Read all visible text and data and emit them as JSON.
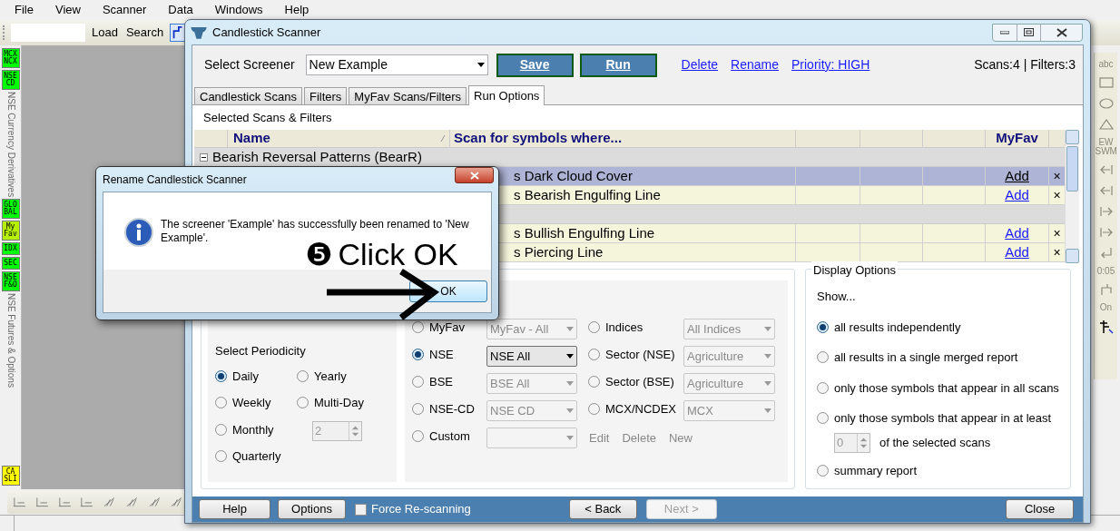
{
  "menu": [
    "File",
    "View",
    "Scanner",
    "Data",
    "Windows",
    "Help"
  ],
  "toolbar": {
    "buttons": [
      "Load",
      "Search"
    ]
  },
  "sidebar": [
    {
      "kind": "badge",
      "lines": [
        "MCX",
        "NCX"
      ],
      "color": "#00ff00"
    },
    {
      "kind": "badge",
      "lines": [
        "NSE",
        "CD"
      ],
      "color": "#00ff00"
    },
    {
      "kind": "label",
      "text": "NSE Currency Derivatives"
    },
    {
      "kind": "badge",
      "lines": [
        "GLO",
        "BAL"
      ],
      "color": "#00ff00"
    },
    {
      "kind": "badge",
      "lines": [
        "My",
        "Fav"
      ],
      "color": "#b4f000"
    },
    {
      "kind": "badge",
      "lines": [
        "IDX"
      ],
      "color": "#00ff00"
    },
    {
      "kind": "badge",
      "lines": [
        "SEC"
      ],
      "color": "#00ff00"
    },
    {
      "kind": "badge",
      "lines": [
        "NSE",
        "F&O"
      ],
      "color": "#00ff00"
    },
    {
      "kind": "label",
      "text": "NSE Futures & Options"
    },
    {
      "kind": "badge",
      "lines": [
        "CA",
        "SLI"
      ],
      "color": "#ffff00"
    }
  ],
  "right_strip": [
    {
      "kind": "text",
      "text": "abc"
    },
    {
      "kind": "rect"
    },
    {
      "kind": "ellipse"
    },
    {
      "kind": "triangle"
    },
    {
      "kind": "text",
      "text": "EW SWM"
    },
    {
      "kind": "arrow_left"
    },
    {
      "kind": "arrow_left"
    },
    {
      "kind": "arrow_right"
    },
    {
      "kind": "arrow_right"
    },
    {
      "kind": "return"
    },
    {
      "kind": "text",
      "text": "0:05"
    },
    {
      "kind": "route"
    },
    {
      "kind": "text",
      "text": "On"
    },
    {
      "kind": "cursor"
    }
  ],
  "window": {
    "title": "Candlestick Scanner",
    "screener_label": "Select Screener",
    "screener_value": "New Example",
    "buttons": [
      "Save",
      "Run"
    ],
    "links": [
      "Delete",
      "Rename",
      "Priority: HIGH"
    ],
    "summary": "Scans:4 | Filters:3",
    "tabs": [
      {
        "label": "Candlestick Scans",
        "selected": false
      },
      {
        "label": "Filters",
        "selected": false
      },
      {
        "label": "MyFav Scans/Filters",
        "selected": false
      },
      {
        "label": "Run Options",
        "selected": true
      }
    ],
    "section_title": "Selected Scans & Filters",
    "table": {
      "columns": [
        "Name",
        "Scan for symbols where...",
        "MyFav"
      ],
      "rows": [
        {
          "kind": "group",
          "label": "Bearish Reversal Patterns (BearR)",
          "expanded": true
        },
        {
          "kind": "scan",
          "scan": "s Dark Cloud Cover",
          "myfav": "Add",
          "remove": "×",
          "selected": true
        },
        {
          "kind": "scan",
          "scan": "s Bearish Engulfing Line",
          "myfav": "Add",
          "remove": "×",
          "selected": false
        },
        {
          "kind": "group"
        },
        {
          "kind": "scan",
          "scan": "s Bullish Engulfing Line",
          "myfav": "Add",
          "remove": "×",
          "selected": false
        },
        {
          "kind": "scan",
          "scan": "s Piercing Line",
          "myfav": "Add",
          "remove": "×",
          "selected": false
        }
      ]
    },
    "periodicity": {
      "title": "Select Periodicity",
      "left": [
        {
          "label": "Daily",
          "selected": true
        },
        {
          "label": "Weekly",
          "selected": false
        },
        {
          "label": "Monthly",
          "selected": false
        },
        {
          "label": "Quarterly",
          "selected": false
        }
      ],
      "right": [
        {
          "label": "Yearly",
          "selected": false
        },
        {
          "label": "Multi-Day",
          "selected": false
        }
      ],
      "multi_day_value": "2"
    },
    "symbols": {
      "left": [
        {
          "label": "MyFav",
          "selected": false,
          "value": "MyFav - All",
          "disabled": true
        },
        {
          "label": "NSE",
          "selected": true,
          "value": "NSE All",
          "disabled": false
        },
        {
          "label": "BSE",
          "selected": false,
          "value": "BSE All",
          "disabled": true
        },
        {
          "label": "NSE-CD",
          "selected": false,
          "value": "NSE CD",
          "disabled": true
        },
        {
          "label": "Custom",
          "selected": false,
          "disabled": true
        }
      ],
      "right": [
        {
          "label": "Indices",
          "selected": false,
          "value": "All Indices",
          "disabled": true
        },
        {
          "label": "Sector (NSE)",
          "selected": false,
          "value": "Agriculture",
          "disabled": true
        },
        {
          "label": "Sector (BSE)",
          "selected": false,
          "value": "Agriculture",
          "disabled": true
        },
        {
          "label": "MCX/NCDEX",
          "selected": false,
          "value": "MCX",
          "disabled": true
        }
      ],
      "actions": [
        "Edit",
        "Delete",
        "New"
      ]
    },
    "display": {
      "title": "Display Options",
      "subtitle": "Show...",
      "options": [
        {
          "kind": "radio",
          "label": "all results independently",
          "selected": true
        },
        {
          "kind": "radio",
          "label": "all results in a single merged report",
          "selected": false
        },
        {
          "kind": "radio",
          "label": "only those symbols that appear in all scans",
          "selected": false
        },
        {
          "kind": "radio_spinner",
          "label": "only those symbols that appear in at least",
          "selected": false,
          "value": "0",
          "suffix": "of the selected scans"
        },
        {
          "kind": "radio",
          "label": "summary report",
          "selected": false
        }
      ]
    },
    "footer": {
      "help": "Help",
      "options": "Options",
      "force": {
        "label": "Force Re-scanning",
        "checked": false
      },
      "back": "< Back",
      "next": {
        "label": "Next >",
        "disabled": true
      },
      "close": "Close"
    }
  },
  "dialog": {
    "title": "Rename Candlestick Scanner",
    "message": "The screener 'Example' has successfully been renamed to 'New Example'.",
    "ok": "OK"
  },
  "annotation": {
    "step": "❺",
    "text": "Click OK"
  }
}
